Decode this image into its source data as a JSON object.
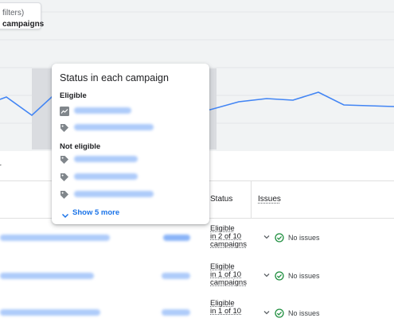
{
  "filter_chip": {
    "line1": "filters)",
    "line2": "campaigns"
  },
  "toolbar": {
    "partial_text": "r"
  },
  "table": {
    "columns": {
      "status": "Status",
      "issues": "Issues"
    },
    "rows": [
      {
        "status": "Eligible\nin 2 of 10\ncampaigns",
        "issues": "No issues"
      },
      {
        "status": "Eligible\nin 1 of 10\ncampaigns",
        "issues": "No issues"
      },
      {
        "status": "Eligible\nin 1 of 10",
        "issues": "No issues"
      }
    ]
  },
  "popover": {
    "title": "Status in each campaign",
    "eligible_heading": "Eligible",
    "not_eligible_heading": "Not eligible",
    "show_more": "Show 5 more",
    "eligible_items": [
      {
        "icon": "trend-chart-icon"
      },
      {
        "icon": "tag-icon"
      }
    ],
    "not_eligible_items": [
      {
        "icon": "tag-icon"
      },
      {
        "icon": "tag-icon"
      },
      {
        "icon": "tag-icon"
      }
    ]
  },
  "colors": {
    "accent": "#1a73e8",
    "chart_line": "#4285f4",
    "success": "#1e8e3e",
    "highlight_band": "#dadce0"
  }
}
